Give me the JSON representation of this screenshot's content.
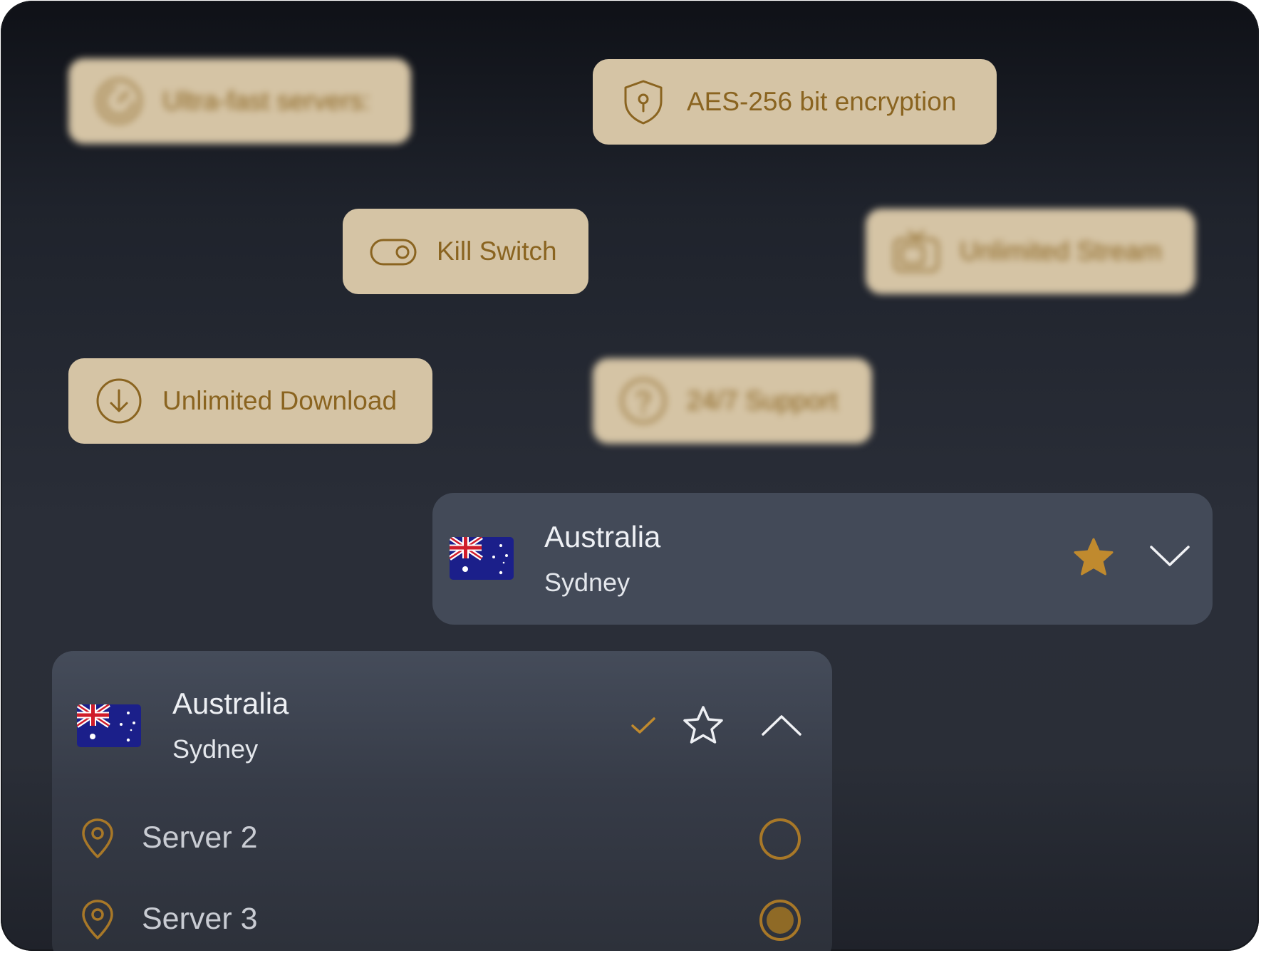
{
  "features": {
    "ultra_fast": "Ultra-fast servers:",
    "encryption": "AES-256 bit encryption",
    "kill_switch": "Kill Switch",
    "stream": "Unlimited Stream",
    "download": "Unlimited Download",
    "support": "24/7 Support"
  },
  "collapsed_location": {
    "country": "Australia",
    "city": "Sydney",
    "favorite": true
  },
  "expanded_location": {
    "country": "Australia",
    "city": "Sydney",
    "favorite": false,
    "connected": true,
    "servers": [
      {
        "label": "Server 2",
        "selected": false
      },
      {
        "label": "Server 3",
        "selected": true
      }
    ]
  },
  "colors": {
    "chip_bg": "#d5c4a5",
    "chip_text": "#8a6420",
    "accent": "#c08a2e",
    "card_bg": "#434a58"
  },
  "icons": {
    "ultra_fast": "speedometer-icon",
    "encryption": "shield-keyhole-icon",
    "kill_switch": "toggle-icon",
    "stream": "tv-icon",
    "download": "download-circle-icon",
    "support": "help-circle-icon"
  }
}
